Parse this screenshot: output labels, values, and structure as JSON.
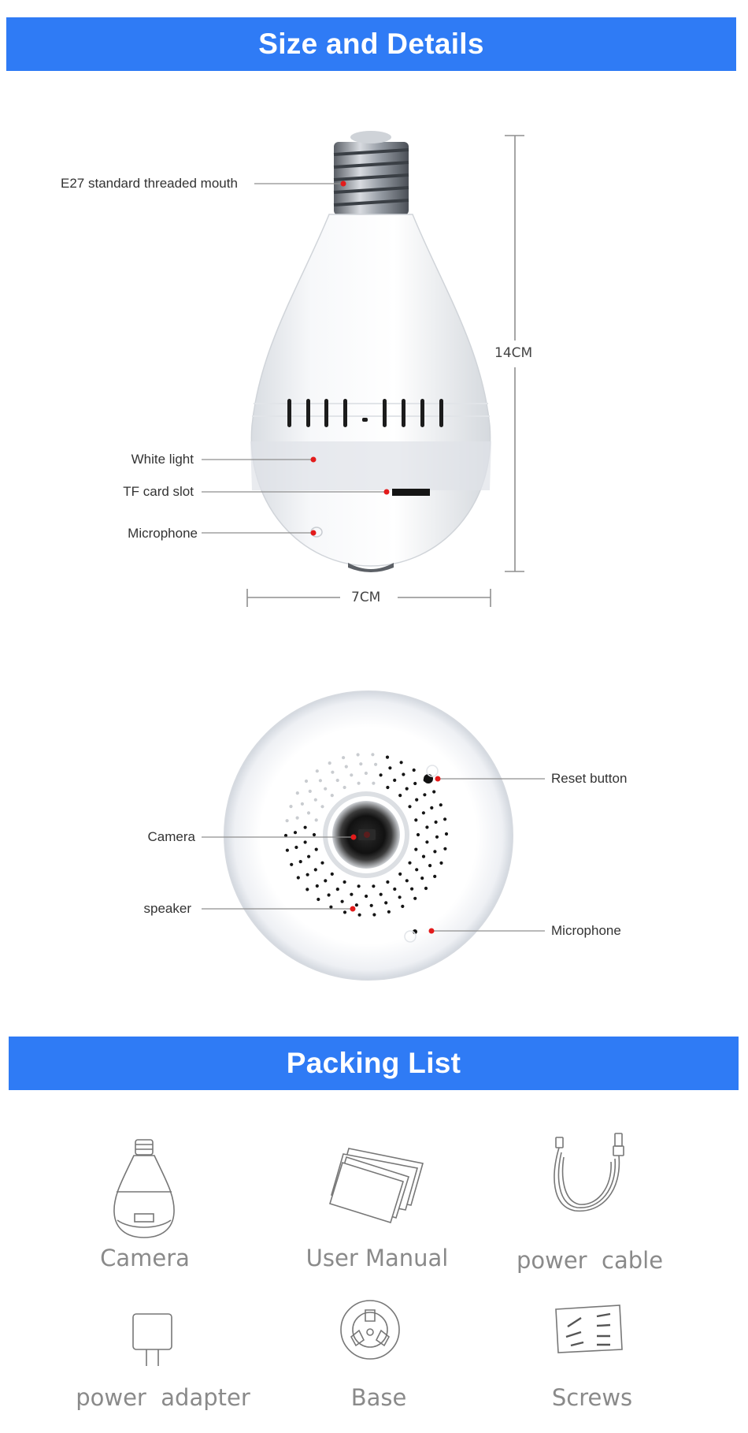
{
  "sections": {
    "size_title": "Size and Details",
    "packing_title": "Packing List"
  },
  "bulb_side": {
    "labels": {
      "threaded_mouth": "E27 standard threaded mouth",
      "white_light": "White light",
      "tf_slot": "TF card slot",
      "microphone": "Microphone"
    },
    "height": "14CM",
    "width": "7CM"
  },
  "bulb_bottom": {
    "labels": {
      "reset": "Reset button",
      "camera": "Camera",
      "speaker": "speaker",
      "microphone": "Microphone"
    }
  },
  "packing_list": {
    "items": [
      {
        "label": "Camera",
        "icon": "bulb-camera-icon"
      },
      {
        "label": "User Manual",
        "icon": "manual-icon"
      },
      {
        "label": "power  cable",
        "icon": "usb-cable-icon"
      },
      {
        "label": "power  adapter",
        "icon": "power-adapter-icon"
      },
      {
        "label": "Base",
        "icon": "base-icon"
      },
      {
        "label": "Screws",
        "icon": "screws-icon"
      }
    ]
  },
  "colors": {
    "banner": "#2f7bf5",
    "marker": "#e31b1b"
  }
}
